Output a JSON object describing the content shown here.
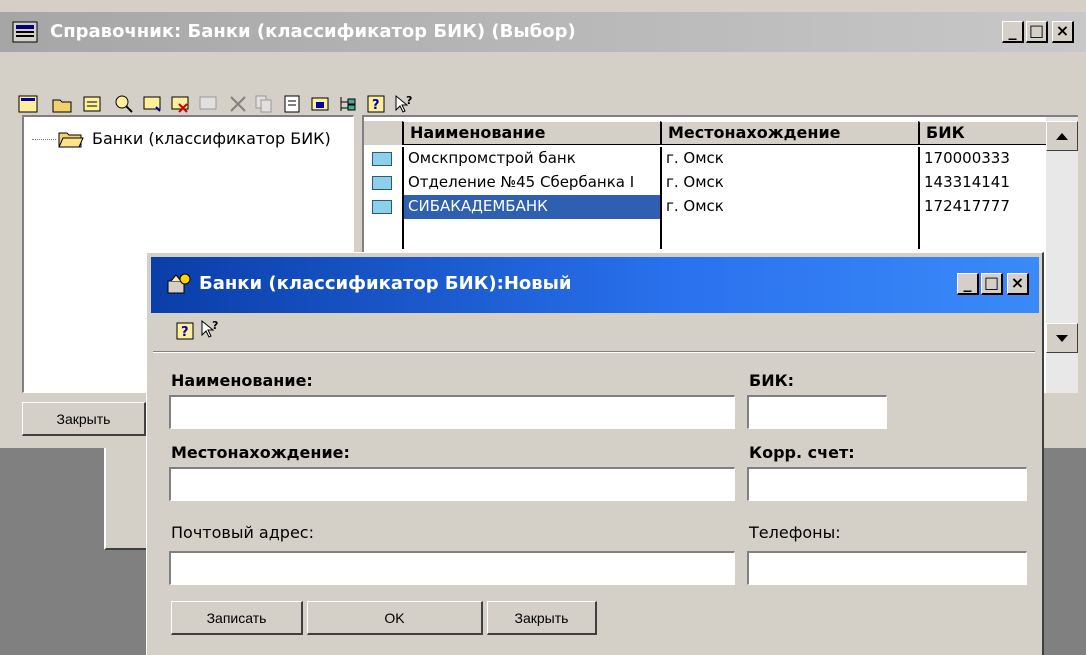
{
  "main_window": {
    "title": "Справочник: Банки (классификатор БИК) (Выбор)",
    "tree_root": "Банки (классификатор БИК)",
    "close_button": "Закрыть",
    "grid": {
      "headers": [
        "Наименование",
        "Местонахождение",
        "БИК"
      ],
      "rows": [
        {
          "name": "Омскпромстрой банк",
          "location": "г. Омск",
          "bik": "170000333"
        },
        {
          "name": "Отделение №45 Сбербанка I",
          "location": "г. Омск",
          "bik": "143314141"
        },
        {
          "name": "СИБАКАДЕМБАНК",
          "location": "г. Омск",
          "bik": "172417777"
        }
      ]
    }
  },
  "dialog": {
    "title": "Банки (классификатор БИК):Новый",
    "fields": {
      "name_label": "Наименование:",
      "bik_label": "БИК:",
      "location_label": "Местонахождение:",
      "corr_label": "Корр. счет:",
      "postal_label": "Почтовый адрес:",
      "phones_label": "Телефоны:",
      "name_value": "",
      "bik_value": "",
      "location_value": "",
      "corr_value": "",
      "postal_value": "",
      "phones_value": ""
    },
    "buttons": {
      "save": "Записать",
      "ok": "OK",
      "close": "Закрыть"
    }
  },
  "caption_buttons": {
    "minimize": "_",
    "maximize": "□",
    "close": "×"
  },
  "colors": {
    "selection": "#2e5fb0",
    "active_title": "#0a3ea8",
    "inactive_title": "#a6a6a6",
    "face": "#d4d0c8"
  }
}
